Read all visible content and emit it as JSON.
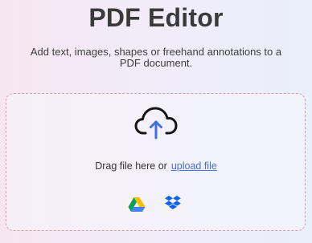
{
  "header": {
    "title": "PDF Editor",
    "subtitle": "Add text, images, shapes or freehand annotations to a PDF document."
  },
  "dropzone": {
    "drag_text": "Drag file here or",
    "upload_link": "upload file",
    "icon": "cloud-upload-icon",
    "services": [
      {
        "name": "google-drive-icon"
      },
      {
        "name": "dropbox-icon"
      }
    ]
  },
  "colors": {
    "accent": "#4a6fd6",
    "border": "#d89aa9",
    "title": "#3a3a3a"
  }
}
